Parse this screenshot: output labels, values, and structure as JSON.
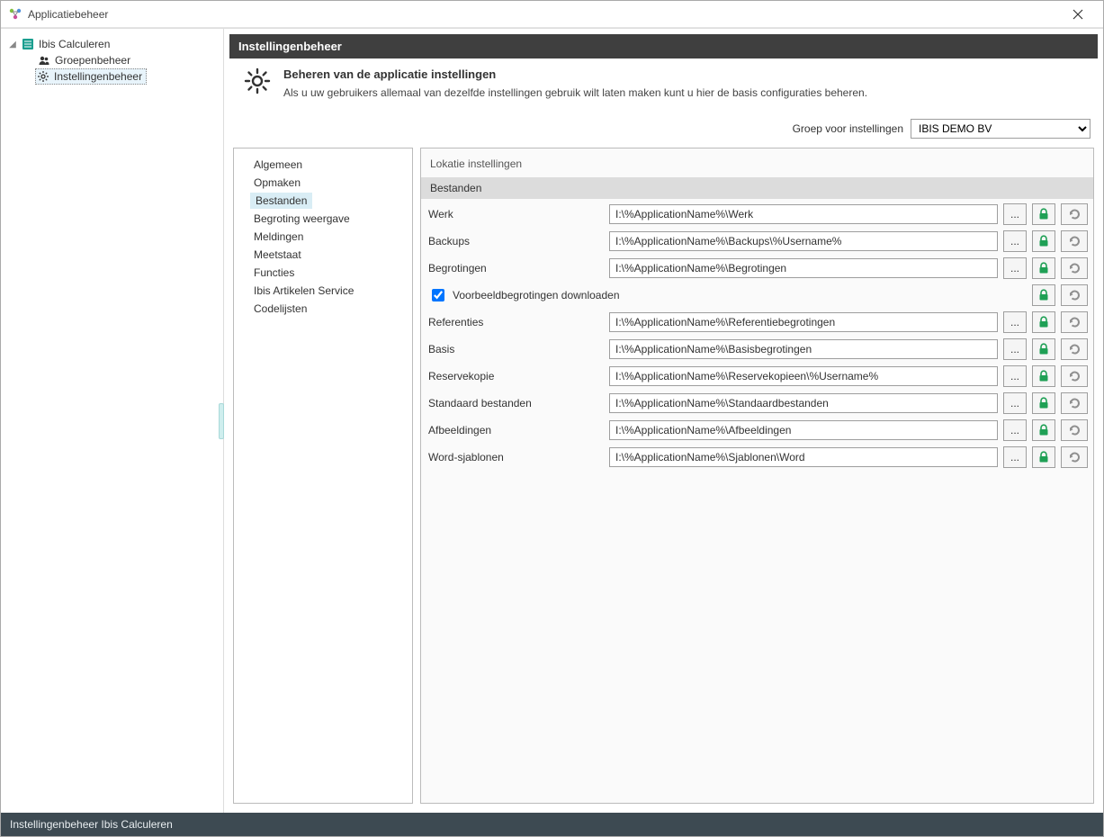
{
  "window": {
    "title": "Applicatiebeheer"
  },
  "tree": {
    "root": "Ibis Calculeren",
    "children": [
      {
        "label": "Groepenbeheer"
      },
      {
        "label": "Instellingenbeheer"
      }
    ]
  },
  "header": {
    "section": "Instellingenbeheer"
  },
  "intro": {
    "title": "Beheren van de applicatie instellingen",
    "desc": "Als u uw gebruikers allemaal van dezelfde instellingen gebruik wilt laten maken kunt u hier de basis configuraties beheren."
  },
  "group": {
    "label": "Groep voor instellingen",
    "value": "IBIS DEMO BV"
  },
  "tabs": [
    "Algemeen",
    "Opmaken",
    "Bestanden",
    "Begroting weergave",
    "Meldingen",
    "Meetstaat",
    "Functies",
    "Ibis Artikelen Service",
    "Codelijsten"
  ],
  "active_tab_index": 2,
  "panel": {
    "title": "Lokatie instellingen",
    "sub_header": "Bestanden"
  },
  "buttons": {
    "ellipsis": "..."
  },
  "fields": [
    {
      "label": "Werk",
      "value": "I:\\%ApplicationName%\\Werk"
    },
    {
      "label": "Backups",
      "value": "I:\\%ApplicationName%\\Backups\\%Username%"
    },
    {
      "label": "Begrotingen",
      "value": "I:\\%ApplicationName%\\Begrotingen"
    }
  ],
  "checkbox": {
    "label": "Voorbeeldbegrotingen downloaden",
    "checked": true
  },
  "fields2": [
    {
      "label": "Referenties",
      "value": "I:\\%ApplicationName%\\Referentiebegrotingen"
    },
    {
      "label": "Basis",
      "value": "I:\\%ApplicationName%\\Basisbegrotingen"
    },
    {
      "label": "Reservekopie",
      "value": "I:\\%ApplicationName%\\Reservekopieen\\%Username%"
    },
    {
      "label": "Standaard bestanden",
      "value": "I:\\%ApplicationName%\\Standaardbestanden"
    },
    {
      "label": "Afbeeldingen",
      "value": "I:\\%ApplicationName%\\Afbeeldingen"
    },
    {
      "label": "Word-sjablonen",
      "value": "I:\\%ApplicationName%\\Sjablonen\\Word"
    }
  ],
  "status": "Instellingenbeheer Ibis Calculeren"
}
